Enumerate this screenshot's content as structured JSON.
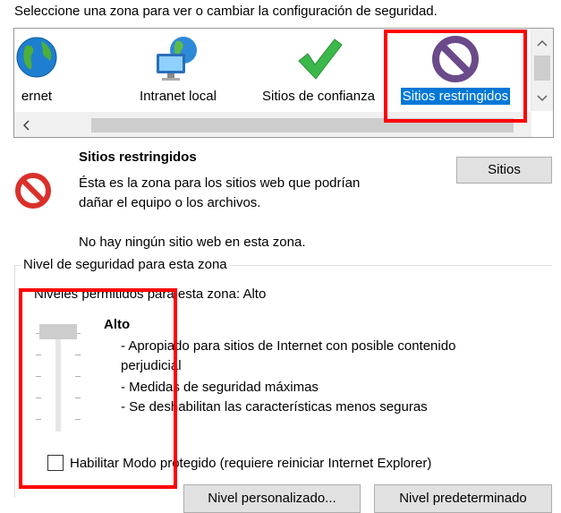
{
  "header": {
    "instruction": "Seleccione una zona para ver o cambiar la configuración de seguridad."
  },
  "zones": [
    {
      "id": "internet",
      "label": "ernet",
      "icon": "globe-icon"
    },
    {
      "id": "intranet",
      "label": "Intranet local",
      "icon": "network-computer-icon"
    },
    {
      "id": "trusted",
      "label": "Sitios de confianza",
      "icon": "green-checkmark-icon"
    },
    {
      "id": "restricted",
      "label": "Sitios restringidos",
      "icon": "prohibited-icon",
      "selected": true
    }
  ],
  "zone_info": {
    "title": "Sitios restringidos",
    "description_line1": "Ésta es la zona para los sitios web que podrían",
    "description_line2": "dañar el equipo o los archivos.",
    "no_sites": "No hay ningún sitio web en esta zona.",
    "sites_button": "Sitios"
  },
  "security_level": {
    "group_label": "Nivel de seguridad para esta zona",
    "allowed_levels": "Niveles permitidos para esta zona: Alto",
    "level_name": "Alto",
    "level_position": 1.0,
    "bullet1_line1": "- Apropiado para sitios de Internet con posible contenido",
    "bullet1_line2": "perjudicial",
    "bullet2": "- Medidas de seguridad máximas",
    "bullet3": "- Se deshabilitan las características menos seguras",
    "protected_mode_label": "Habilitar Modo protegido (requiere reiniciar Internet Explorer)",
    "protected_mode_checked": false,
    "custom_level_button": "Nivel personalizado...",
    "default_level_button": "Nivel predeterminado"
  },
  "colors": {
    "highlight": "#ff0000",
    "selection": "#0078d7"
  }
}
